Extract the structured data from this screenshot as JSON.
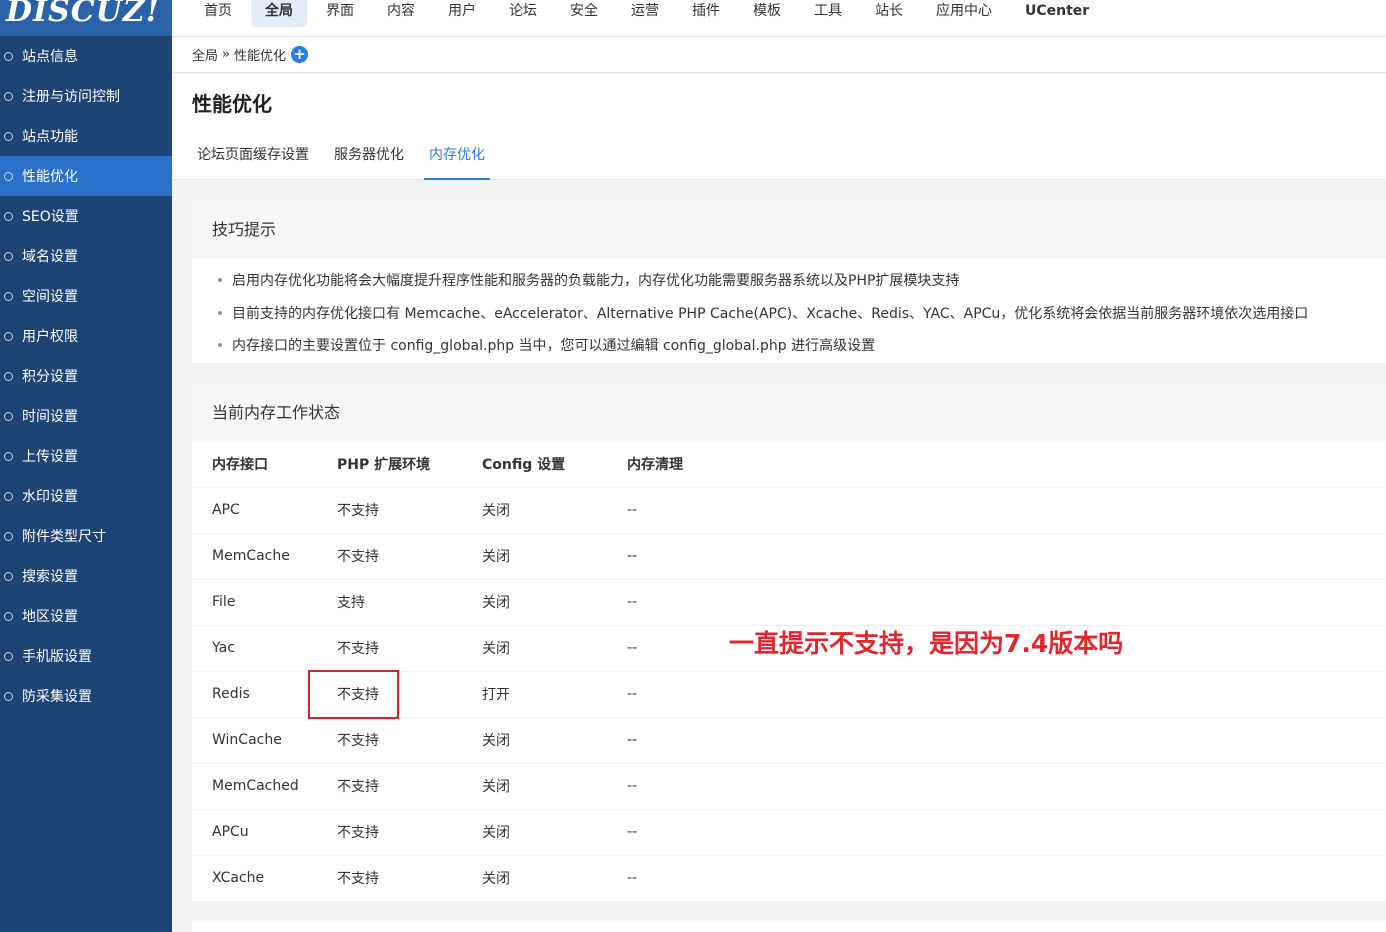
{
  "logo": "DISCUZ!",
  "sidebar": {
    "items": [
      {
        "label": "站点信息"
      },
      {
        "label": "注册与访问控制"
      },
      {
        "label": "站点功能"
      },
      {
        "label": "性能优化",
        "active": true
      },
      {
        "label": "SEO设置"
      },
      {
        "label": "域名设置"
      },
      {
        "label": "空间设置"
      },
      {
        "label": "用户权限"
      },
      {
        "label": "积分设置"
      },
      {
        "label": "时间设置"
      },
      {
        "label": "上传设置"
      },
      {
        "label": "水印设置"
      },
      {
        "label": "附件类型尺寸"
      },
      {
        "label": "搜索设置"
      },
      {
        "label": "地区设置"
      },
      {
        "label": "手机版设置"
      },
      {
        "label": "防采集设置"
      }
    ]
  },
  "topnav": {
    "items": [
      "首页",
      "全局",
      "界面",
      "内容",
      "用户",
      "论坛",
      "安全",
      "运营",
      "插件",
      "模板",
      "工具",
      "站长",
      "应用中心",
      "UCenter"
    ],
    "active_index": 1
  },
  "breadcrumb": {
    "root": "全局",
    "sep": "»",
    "current": "性能优化",
    "plus": "+"
  },
  "page": {
    "title": "性能优化",
    "tabs": [
      "论坛页面缓存设置",
      "服务器优化",
      "内存优化"
    ],
    "active_tab": 2
  },
  "tips": {
    "title": "技巧提示",
    "items": [
      "启用内存优化功能将会大幅度提升程序性能和服务器的负载能力，内存优化功能需要服务器系统以及PHP扩展模块支持",
      "目前支持的内存优化接口有 Memcache、eAccelerator、Alternative PHP Cache(APC)、Xcache、Redis、YAC、APCu，优化系统将会依据当前服务器环境依次选用接口",
      "内存接口的主要设置位于 config_global.php 当中，您可以通过编辑 config_global.php 进行高级设置"
    ]
  },
  "status": {
    "title": "当前内存工作状态",
    "headers": [
      "内存接口",
      "PHP 扩展环境",
      "Config 设置",
      "内存清理"
    ],
    "rows": [
      [
        "APC",
        "不支持",
        "关闭",
        "--"
      ],
      [
        "MemCache",
        "不支持",
        "关闭",
        "--"
      ],
      [
        "File",
        "支持",
        "关闭",
        "--"
      ],
      [
        "Yac",
        "不支持",
        "关闭",
        "--"
      ],
      [
        "Redis",
        "不支持",
        "打开",
        "--"
      ],
      [
        "WinCache",
        "不支持",
        "关闭",
        "--"
      ],
      [
        "MemCached",
        "不支持",
        "关闭",
        "--"
      ],
      [
        "APCu",
        "不支持",
        "关闭",
        "--"
      ],
      [
        "XCache",
        "不支持",
        "关闭",
        "--"
      ]
    ]
  },
  "annotation": "一直提示不支持，是因为7.4版本吗",
  "colors": {
    "sidebar_bg": "#1d4474",
    "sidebar_active": "#2a70c8",
    "accent": "#2c7be5",
    "annotation": "#e3262d"
  }
}
